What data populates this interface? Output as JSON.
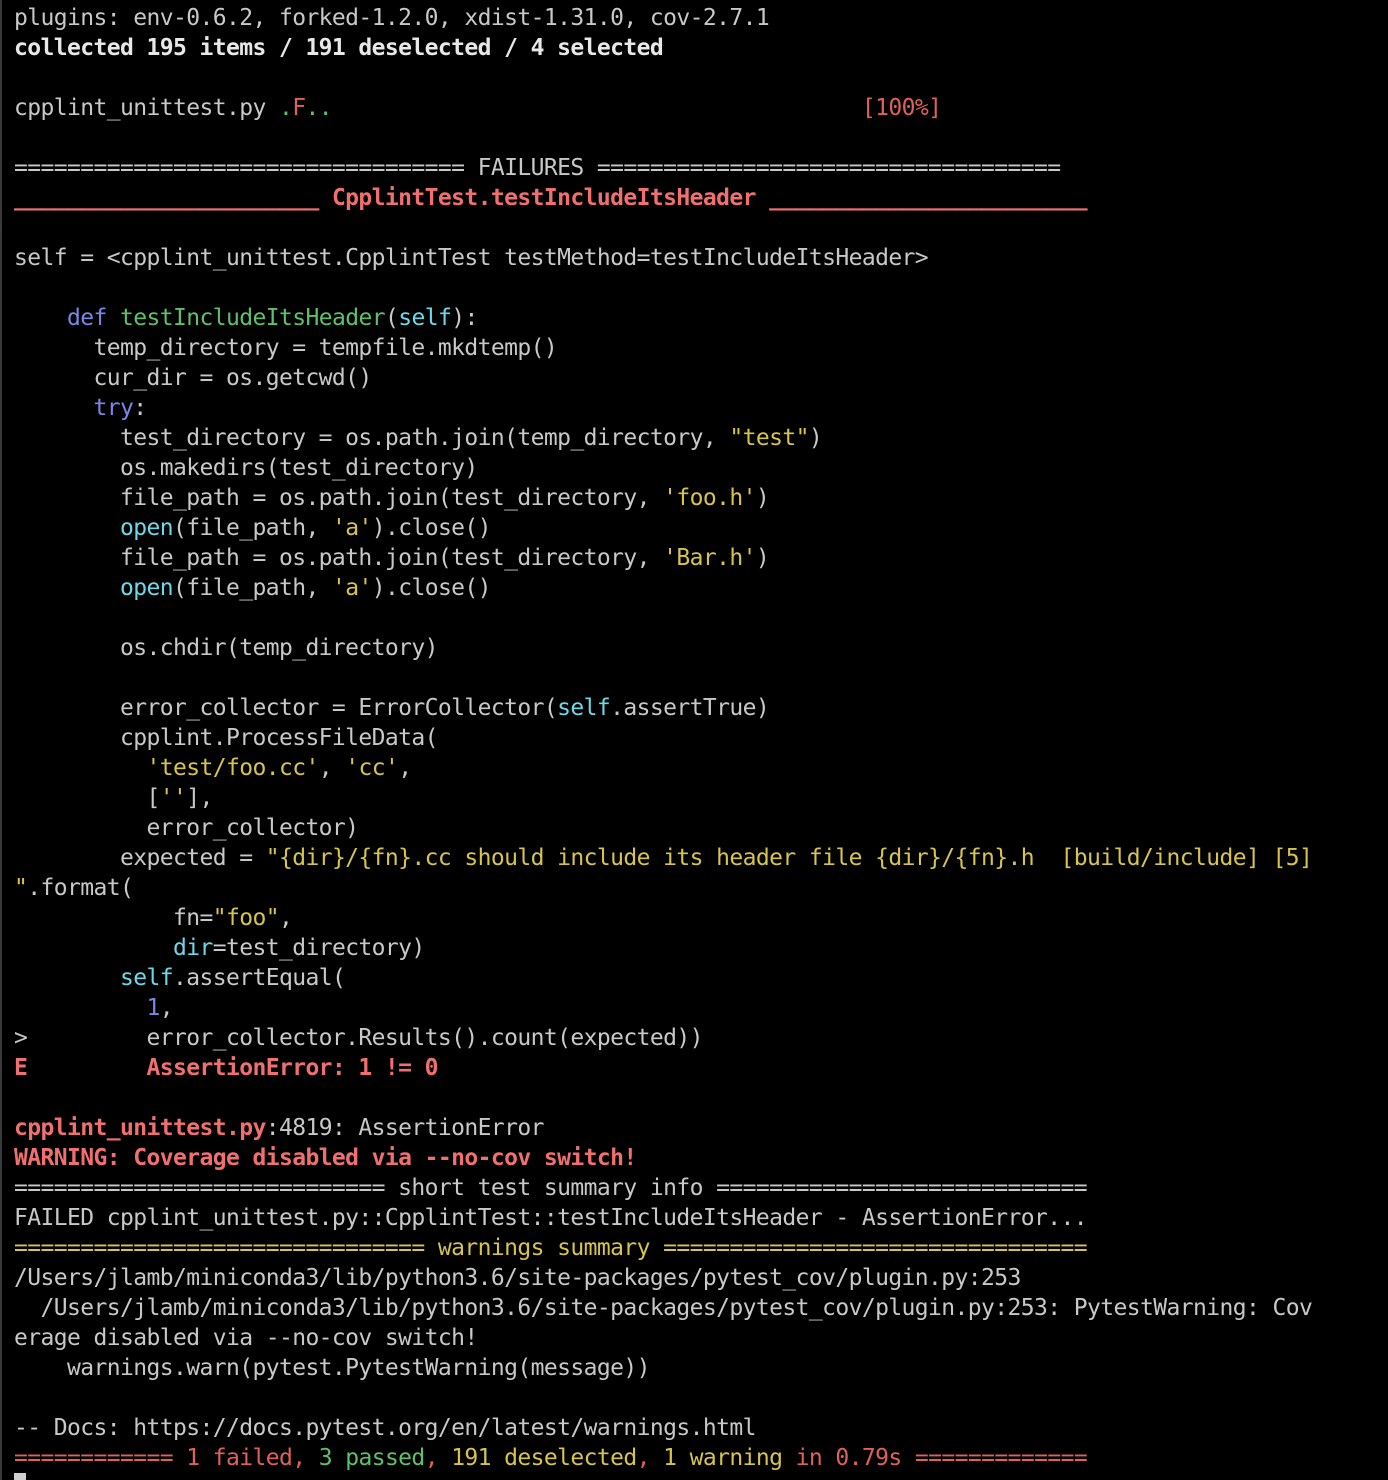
{
  "terminal": {
    "lines": [
      [
        {
          "t": "plugins: env-0.6.2, forked-1.2.0, xdist-1.31.0, cov-2.7.1",
          "c": "dim"
        }
      ],
      [
        {
          "t": "collected 195 items / 191 deselected / 4 selected",
          "c": "white b"
        }
      ],
      [],
      [
        {
          "t": "cpplint_unittest.py ",
          "c": "dim"
        },
        {
          "t": ".",
          "c": "green"
        },
        {
          "t": "F",
          "c": "red"
        },
        {
          "t": "..",
          "c": "green"
        },
        {
          "t": "                                        [100%]",
          "c": "red"
        }
      ],
      [],
      [
        {
          "t": "================================== FAILURES ===================================",
          "c": "dim"
        }
      ],
      [
        {
          "t": "_______________________ ",
          "c": "lred b"
        },
        {
          "t": "CpplintTest.testIncludeItsHeader",
          "c": "lred b"
        },
        {
          "t": " ________________________",
          "c": "lred b"
        }
      ],
      [],
      [
        {
          "t": "self = <cpplint_unittest.CpplintTest testMethod=testIncludeItsHeader>",
          "c": "dim"
        }
      ],
      [],
      [
        {
          "t": "    ",
          "c": "dim"
        },
        {
          "t": "def",
          "c": "blue"
        },
        {
          "t": " ",
          "c": "dim"
        },
        {
          "t": "testIncludeItsHeader",
          "c": "green"
        },
        {
          "t": "(",
          "c": "dim"
        },
        {
          "t": "self",
          "c": "cyan"
        },
        {
          "t": "):",
          "c": "dim"
        }
      ],
      [
        {
          "t": "      temp_directory = tempfile.mkdtemp()",
          "c": "dim"
        }
      ],
      [
        {
          "t": "      cur_dir = os.getcwd()",
          "c": "dim"
        }
      ],
      [
        {
          "t": "      ",
          "c": "dim"
        },
        {
          "t": "try",
          "c": "blue"
        },
        {
          "t": ":",
          "c": "dim"
        }
      ],
      [
        {
          "t": "        test_directory = os.path.join(temp_directory, ",
          "c": "dim"
        },
        {
          "t": "\"test\"",
          "c": "yellow"
        },
        {
          "t": ")",
          "c": "dim"
        }
      ],
      [
        {
          "t": "        os.makedirs(test_directory)",
          "c": "dim"
        }
      ],
      [
        {
          "t": "        file_path = os.path.join(test_directory, ",
          "c": "dim"
        },
        {
          "t": "'foo.h'",
          "c": "yellow"
        },
        {
          "t": ")",
          "c": "dim"
        }
      ],
      [
        {
          "t": "        ",
          "c": "dim"
        },
        {
          "t": "open",
          "c": "cyan"
        },
        {
          "t": "(file_path, ",
          "c": "dim"
        },
        {
          "t": "'a'",
          "c": "yellow"
        },
        {
          "t": ").close()",
          "c": "dim"
        }
      ],
      [
        {
          "t": "        file_path = os.path.join(test_directory, ",
          "c": "dim"
        },
        {
          "t": "'Bar.h'",
          "c": "yellow"
        },
        {
          "t": ")",
          "c": "dim"
        }
      ],
      [
        {
          "t": "        ",
          "c": "dim"
        },
        {
          "t": "open",
          "c": "cyan"
        },
        {
          "t": "(file_path, ",
          "c": "dim"
        },
        {
          "t": "'a'",
          "c": "yellow"
        },
        {
          "t": ").close()",
          "c": "dim"
        }
      ],
      [],
      [
        {
          "t": "        os.chdir(temp_directory)",
          "c": "dim"
        }
      ],
      [],
      [
        {
          "t": "        error_collector = ErrorCollector(",
          "c": "dim"
        },
        {
          "t": "self",
          "c": "cyan"
        },
        {
          "t": ".assertTrue)",
          "c": "dim"
        }
      ],
      [
        {
          "t": "        cpplint.ProcessFileData(",
          "c": "dim"
        }
      ],
      [
        {
          "t": "          ",
          "c": "dim"
        },
        {
          "t": "'test/foo.cc'",
          "c": "yellow"
        },
        {
          "t": ", ",
          "c": "dim"
        },
        {
          "t": "'cc'",
          "c": "yellow"
        },
        {
          "t": ",",
          "c": "dim"
        }
      ],
      [
        {
          "t": "          [",
          "c": "dim"
        },
        {
          "t": "''",
          "c": "yellow"
        },
        {
          "t": "],",
          "c": "dim"
        }
      ],
      [
        {
          "t": "          error_collector)",
          "c": "dim"
        }
      ],
      [
        {
          "t": "        expected = ",
          "c": "dim"
        },
        {
          "t": "\"{dir}/{fn}.cc should include its header file {dir}/{fn}.h  [build/include] [5]",
          "c": "yellow"
        }
      ],
      [
        {
          "t": "\"",
          "c": "yellow"
        },
        {
          "t": ".format(",
          "c": "dim"
        }
      ],
      [
        {
          "t": "            fn=",
          "c": "dim"
        },
        {
          "t": "\"foo\"",
          "c": "yellow"
        },
        {
          "t": ",",
          "c": "dim"
        }
      ],
      [
        {
          "t": "            ",
          "c": "dim"
        },
        {
          "t": "dir",
          "c": "cyan"
        },
        {
          "t": "=test_directory)",
          "c": "dim"
        }
      ],
      [
        {
          "t": "        ",
          "c": "dim"
        },
        {
          "t": "self",
          "c": "cyan"
        },
        {
          "t": ".assertEqual(",
          "c": "dim"
        }
      ],
      [
        {
          "t": "          ",
          "c": "dim"
        },
        {
          "t": "1",
          "c": "blue"
        },
        {
          "t": ",",
          "c": "dim"
        }
      ],
      [
        {
          "t": ">         error_collector.Results().count(expected))",
          "c": "dim"
        }
      ],
      [
        {
          "t": "E         AssertionError: 1 != 0",
          "c": "lred b"
        }
      ],
      [],
      [
        {
          "t": "cpplint_unittest.py",
          "c": "lred b"
        },
        {
          "t": ":4819: AssertionError",
          "c": "dim"
        }
      ],
      [
        {
          "t": "WARNING: Coverage disabled via --no-cov switch!",
          "c": "lred b"
        }
      ],
      [
        {
          "t": "============================ short test summary info ============================",
          "c": "dim"
        }
      ],
      [
        {
          "t": "FAILED cpplint_unittest.py::CpplintTest::testIncludeItsHeader - AssertionError...",
          "c": "dim"
        }
      ],
      [
        {
          "t": "=============================== warnings summary ================================",
          "c": "yellow"
        }
      ],
      [
        {
          "t": "/Users/jlamb/miniconda3/lib/python3.6/site-packages/pytest_cov/plugin.py:253",
          "c": "dim"
        }
      ],
      [
        {
          "t": "  /Users/jlamb/miniconda3/lib/python3.6/site-packages/pytest_cov/plugin.py:253: PytestWarning: Cov",
          "c": "dim"
        }
      ],
      [
        {
          "t": "erage disabled via --no-cov switch!",
          "c": "dim"
        }
      ],
      [
        {
          "t": "    warnings.warn(pytest.PytestWarning(message))",
          "c": "dim"
        }
      ],
      [],
      [
        {
          "t": "-- Docs: https://docs.pytest.org/en/latest/warnings.html",
          "c": "dim"
        }
      ],
      [
        {
          "t": "============ ",
          "c": "red"
        },
        {
          "t": "1 failed",
          "c": "red"
        },
        {
          "t": ", ",
          "c": "red"
        },
        {
          "t": "3 passed",
          "c": "green"
        },
        {
          "t": ", ",
          "c": "red"
        },
        {
          "t": "191 deselected",
          "c": "yellow"
        },
        {
          "t": ", ",
          "c": "red"
        },
        {
          "t": "1 warning",
          "c": "yellow"
        },
        {
          "t": " in ",
          "c": "red"
        },
        {
          "t": "0.79s",
          "c": "red"
        },
        {
          "t": " =============",
          "c": "red"
        }
      ]
    ]
  },
  "colors": {
    "background": "#000000",
    "text": "#c8c8c8",
    "red": "#e0605a",
    "green": "#5ec06a",
    "yellow": "#d6c44c",
    "blue": "#7a86e8",
    "cyan": "#6fd8e8"
  }
}
